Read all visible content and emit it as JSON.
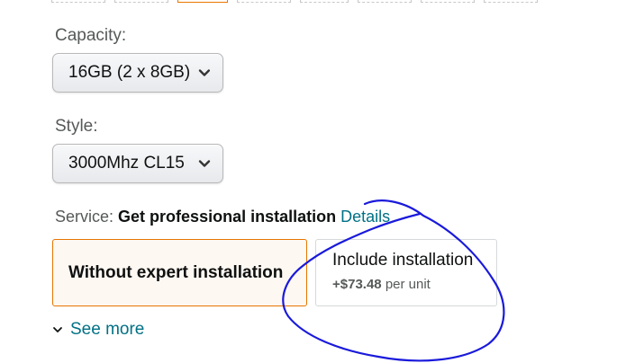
{
  "capacity": {
    "label": "Capacity:",
    "selected": "16GB (2 x 8GB)"
  },
  "style": {
    "label": "Style:",
    "selected": "3000Mhz CL15"
  },
  "service": {
    "label": "Service:",
    "value": "Get professional installation",
    "details_link": "Details"
  },
  "options": {
    "without": {
      "title": "Without expert installation"
    },
    "include": {
      "title": "Include installation",
      "price": "+$73.48",
      "per_unit": "per unit"
    }
  },
  "see_more": {
    "label": "See more"
  },
  "colors": {
    "accent_orange": "#e77600",
    "link_teal": "#007185",
    "annotation_blue": "#1a1adb"
  },
  "icons": {
    "select_chevron": "chevron-down-icon",
    "see_more_chevron": "chevron-down-icon"
  }
}
